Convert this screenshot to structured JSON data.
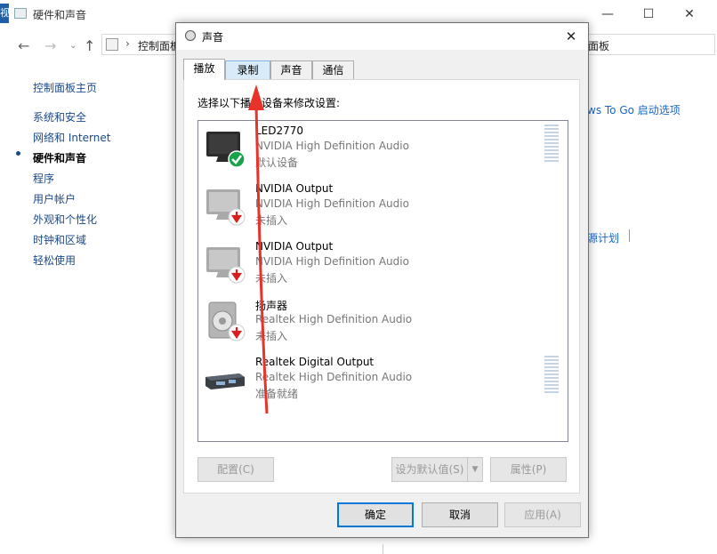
{
  "background_window": {
    "app_icon_text": "视",
    "title": "硬件和声音",
    "controls": {
      "minimize": "—",
      "maximize": "☐",
      "close": "✕"
    },
    "nav": {
      "back": "←",
      "forward": "→",
      "dropdown": "⌄",
      "up": "↑"
    },
    "address": {
      "separator": "›",
      "path": "控制面板",
      "search_fragment": "面板"
    },
    "sidebar": {
      "home": "控制面板主页",
      "items": [
        "系统和安全",
        "网络和 Internet",
        "硬件和声音",
        "程序",
        "用户帐户",
        "外观和个性化",
        "时钟和区域",
        "轻松使用"
      ],
      "active_index": 2
    },
    "right_links": [
      "ws To Go 启动选项",
      "源计划"
    ]
  },
  "dialog": {
    "title": "声音",
    "close": "✕",
    "tabs": [
      "播放",
      "录制",
      "声音",
      "通信"
    ],
    "selected_tab": 0,
    "prompt": "选择以下播放设备来修改设置:",
    "devices": [
      {
        "name": "LED2770",
        "driver": "NVIDIA High Definition Audio",
        "status": "默认设备",
        "icon": "monitor-icon",
        "badge": "default-check-icon",
        "level_meter": true
      },
      {
        "name": "NVIDIA Output",
        "driver": "NVIDIA High Definition Audio",
        "status": "未插入",
        "icon": "monitor-icon",
        "badge": "unplugged-icon",
        "level_meter": false
      },
      {
        "name": "NVIDIA Output",
        "driver": "NVIDIA High Definition Audio",
        "status": "未插入",
        "icon": "monitor-icon",
        "badge": "unplugged-icon",
        "level_meter": false
      },
      {
        "name": "扬声器",
        "driver": "Realtek High Definition Audio",
        "status": "未插入",
        "icon": "speaker-icon",
        "badge": "unplugged-icon",
        "level_meter": false
      },
      {
        "name": "Realtek Digital Output",
        "driver": "Realtek High Definition Audio",
        "status": "准备就绪",
        "icon": "digital-output-icon",
        "badge": "",
        "level_meter": true
      }
    ],
    "buttons": {
      "configure": "配置(C)",
      "set_default": "设为默认值(S)",
      "properties": "属性(P)",
      "ok": "确定",
      "cancel": "取消",
      "apply": "应用(A)"
    }
  },
  "colors": {
    "link": "#1a4a8a",
    "annotation_arrow": "#e8332a",
    "default_button_border": "#0078d7"
  }
}
